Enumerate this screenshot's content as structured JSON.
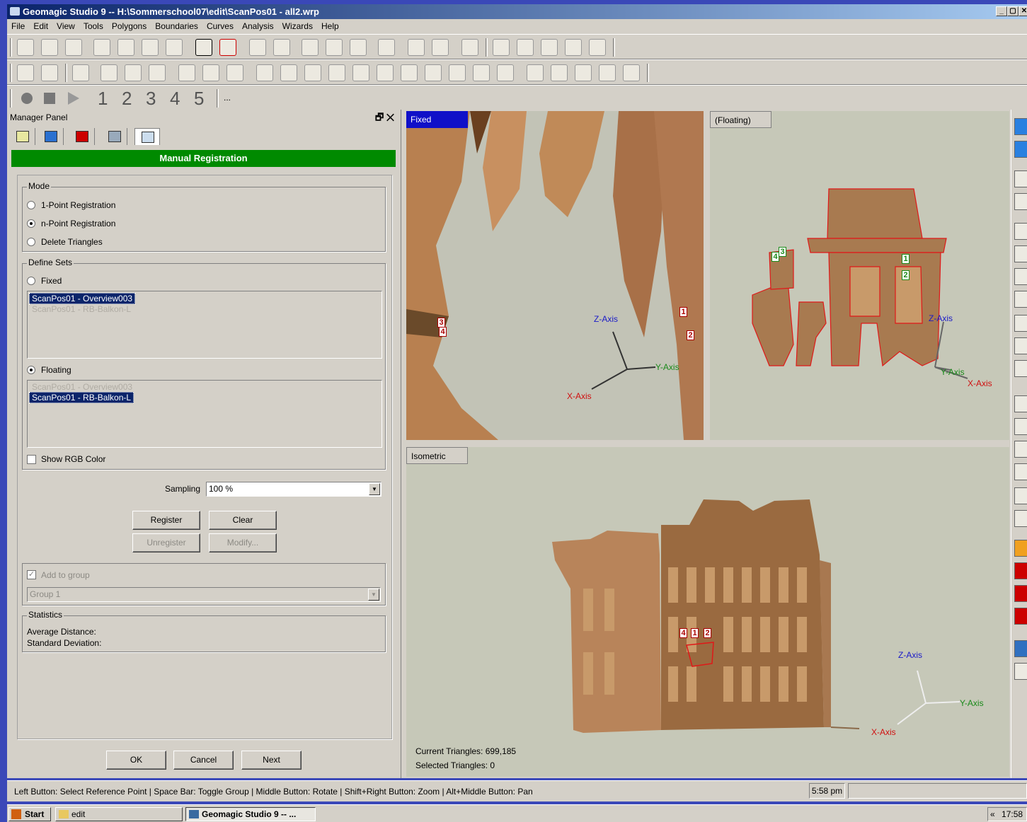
{
  "window": {
    "title": "Geomagic Studio 9 -- H:\\Sommerschool07\\edit\\ScanPos01 - all2.wrp",
    "controls": [
      "_",
      "▢",
      "✕"
    ]
  },
  "menu": [
    "File",
    "Edit",
    "View",
    "Tools",
    "Polygons",
    "Boundaries",
    "Curves",
    "Analysis",
    "Wizards",
    "Help"
  ],
  "macro_toolbar": {
    "numbers": [
      "1",
      "2",
      "3",
      "4",
      "5"
    ],
    "more": "..."
  },
  "manager": {
    "title": "Manager Panel",
    "controls": "🗗 ✕",
    "header": "Manual Registration"
  },
  "mode": {
    "legend": "Mode",
    "options": [
      "1-Point Registration",
      "n-Point Registration",
      "Delete Triangles"
    ],
    "selected": 1
  },
  "define_sets": {
    "legend": "Define Sets",
    "fixed_label": "Fixed",
    "fixed_items": [
      "ScanPos01 - Overview003",
      "ScanPos01 - RB-Balkon-L"
    ],
    "floating_label": "Floating",
    "floating_items": [
      "ScanPos01 - Overview003",
      "ScanPos01 - RB-Balkon-L"
    ],
    "show_rgb": "Show RGB Color"
  },
  "sampling": {
    "label": "Sampling",
    "value": "100 %"
  },
  "buttons": {
    "register": "Register",
    "clear": "Clear",
    "unregister": "Unregister",
    "modify": "Modify..."
  },
  "group": {
    "add_label": "Add to group",
    "value": "Group 1"
  },
  "statistics": {
    "legend": "Statistics",
    "avg": "Average Distance:",
    "std": "Standard Deviation:"
  },
  "footer": {
    "ok": "OK",
    "cancel": "Cancel",
    "next": "Next"
  },
  "viewports": {
    "fixed": "Fixed",
    "floating": "(Floating)",
    "iso": "Isometric",
    "axes": {
      "x": "X-Axis",
      "y": "Y-Axis",
      "z": "Z-Axis"
    },
    "markers": [
      "1",
      "2",
      "3",
      "4"
    ],
    "current_triangles": "Current Triangles: 699,185",
    "selected_triangles": "Selected Triangles: 0"
  },
  "status": {
    "hint": "Left Button: Select Reference Point | Space Bar: Toggle Group | Middle Button: Rotate | Shift+Right Button: Zoom | Alt+Middle Button: Pan",
    "time": "5:58 pm"
  },
  "taskbar": {
    "start": "Start",
    "items": [
      "edit",
      "Geomagic Studio 9 -- ..."
    ],
    "clock": "17:58",
    "chevron": "«"
  },
  "colors": {
    "title_start": "#0a246a",
    "header_green": "#008a00",
    "model": "#c08a58",
    "marker_red": "#a00000",
    "marker_green": "#1a8a1a",
    "viewport_bg": "#c6c8b8"
  }
}
